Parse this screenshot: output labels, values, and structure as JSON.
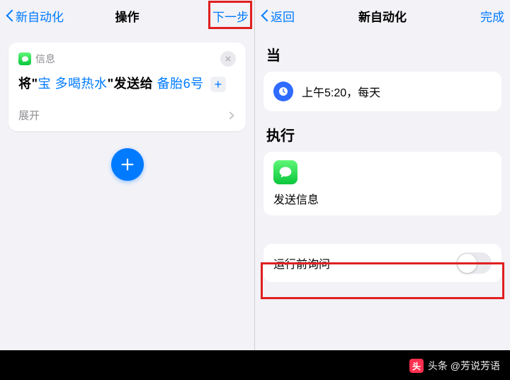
{
  "left": {
    "nav": {
      "back": "新自动化",
      "title": "操作",
      "next": "下一步"
    },
    "card": {
      "app_label": "信息",
      "prefix": "将\"",
      "token1": "宝 多喝热水",
      "mid": "\"发送给",
      "token2": "备胎6号",
      "expand": "展开"
    }
  },
  "right": {
    "nav": {
      "back": "返回",
      "title": "新自动化",
      "done": "完成"
    },
    "when_label": "当",
    "when_text": "上午5:20，每天",
    "do_label": "执行",
    "action_label": "发送信息",
    "ask_label": "运行前询问"
  },
  "watermark": "头条 @芳说芳语"
}
